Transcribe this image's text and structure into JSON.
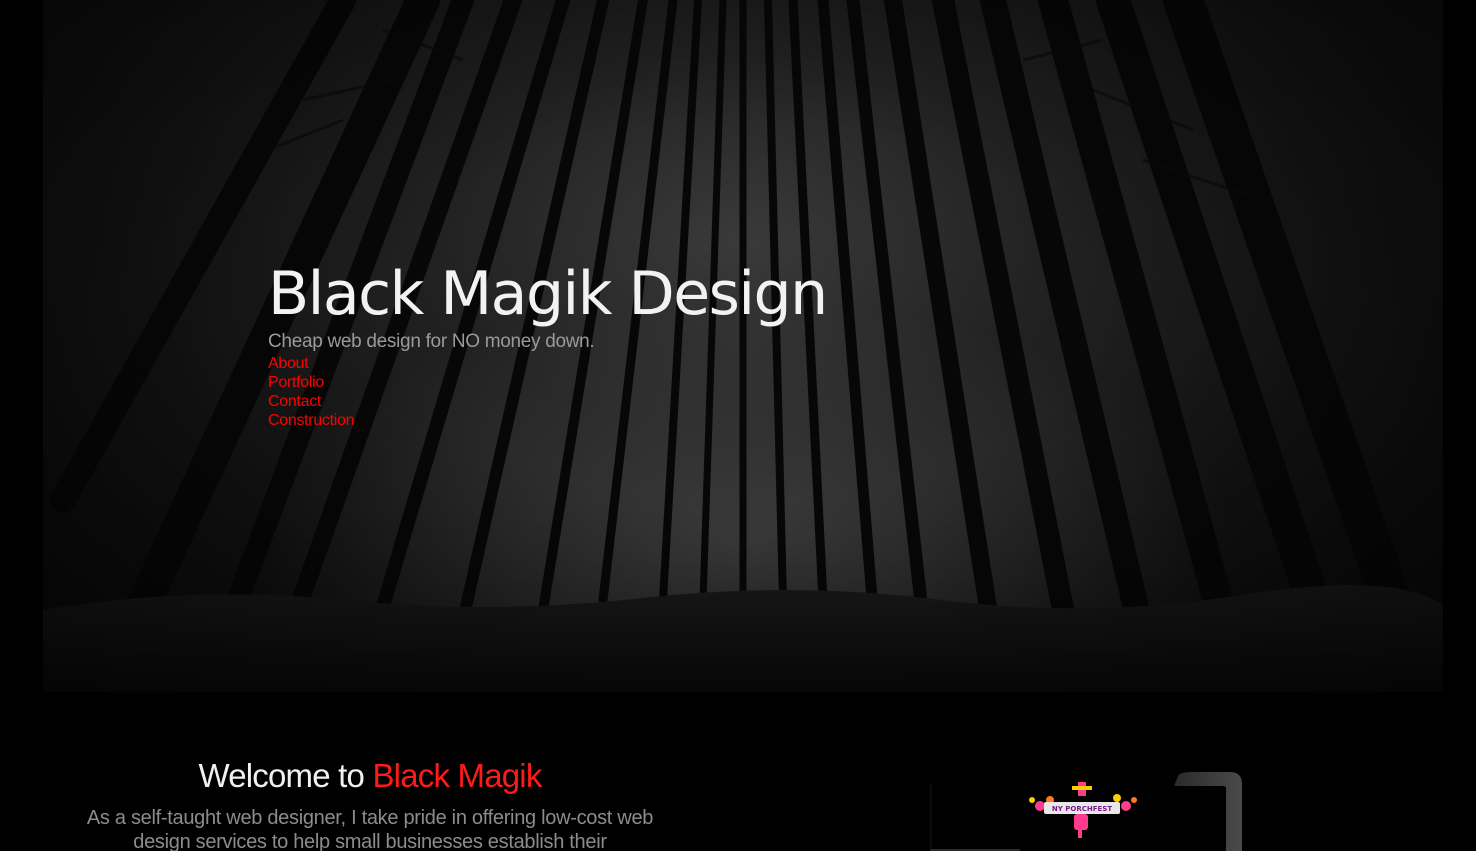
{
  "hero": {
    "title": "Black Magik Design",
    "tagline": "Cheap web design for NO money down."
  },
  "nav": {
    "items": [
      {
        "label": "About"
      },
      {
        "label": "Portfolio"
      },
      {
        "label": "Contact"
      },
      {
        "label": "Construction"
      }
    ]
  },
  "welcome": {
    "heading_prefix": "Welcome to ",
    "heading_accent": "Black Magik",
    "body": "As a self-taught web designer, I take pride in offering low-cost web design services to help small businesses establish their"
  },
  "portfolio_preview": {
    "logo_text": "NY PORCHFEST"
  },
  "colors": {
    "accent": "#ff0000",
    "background": "#000000",
    "title": "#f2f2f2",
    "muted": "#9a9a9a"
  }
}
